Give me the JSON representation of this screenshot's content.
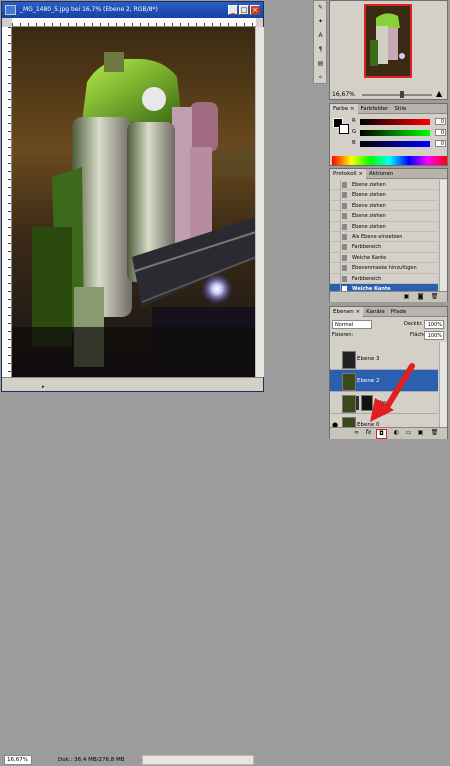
{
  "document": {
    "title": "_MG_1480_5.jpg bei 16,7% (Ebene 2, RGB/8*)",
    "zoom": "16,67%",
    "doc_info": "Dok.: 36,4 MB/276,8 MB"
  },
  "navigator": {
    "zoom": "16,67%"
  },
  "color_panel": {
    "tabs": [
      "Farbe ×",
      "Farbfelder",
      "Stile"
    ],
    "labels": [
      "R",
      "G",
      "B"
    ],
    "values": [
      "0",
      "0",
      "0"
    ]
  },
  "history_panel": {
    "tabs": [
      "Protokoll ×",
      "Aktionen"
    ],
    "items": [
      "Ebene ziehen",
      "Ebene ziehen",
      "Ebene ziehen",
      "Ebene ziehen",
      "Ebene ziehen",
      "Als Ebene einsetzen",
      "Farbbereich",
      "Weiche Kante",
      "Ebenenmaske hinzufügen",
      "Farbbereich",
      "Weiche Kante"
    ],
    "selected_index": 10
  },
  "layers_panel": {
    "tabs": [
      "Ebenen ×",
      "Kanäle",
      "Pfade"
    ],
    "blend_mode": "Normal",
    "opacity_label": "Deckkr.",
    "opacity": "100%",
    "lock_label": "Fixieren:",
    "fill_label": "Fläche:",
    "fill": "100%",
    "layers": [
      {
        "name": "Ebene 3"
      },
      {
        "name": "Ebene 2"
      },
      {
        "name": "Ebe"
      },
      {
        "name": "Ebene 0"
      }
    ],
    "selected_layer": 1
  },
  "colors": {
    "highlight": "#2d5fb0",
    "arrow": "#e02020",
    "titlebar": "#1941a5"
  }
}
